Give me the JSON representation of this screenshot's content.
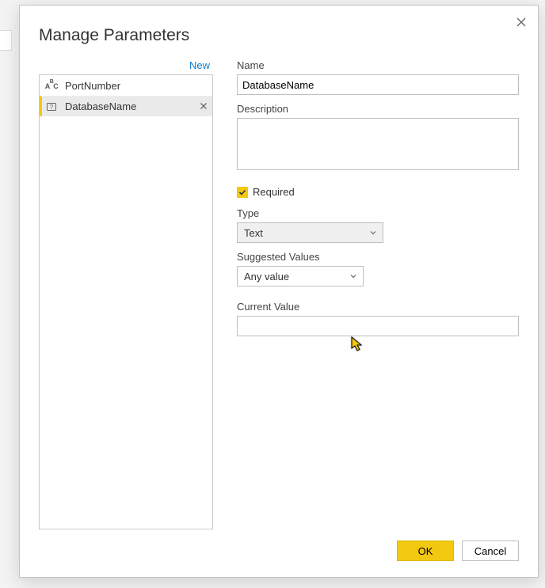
{
  "title": "Manage Parameters",
  "new_link": "New",
  "parameters": [
    {
      "name": "PortNumber",
      "icon": "abc"
    },
    {
      "name": "DatabaseName",
      "icon": "param"
    }
  ],
  "selected_index": 1,
  "form": {
    "name_label": "Name",
    "name_value": "DatabaseName",
    "description_label": "Description",
    "description_value": "",
    "required_checked": true,
    "required_label": "Required",
    "type_label": "Type",
    "type_value": "Text",
    "suggested_label": "Suggested Values",
    "suggested_value": "Any value",
    "current_label": "Current Value",
    "current_value": ""
  },
  "buttons": {
    "ok": "OK",
    "cancel": "Cancel"
  }
}
